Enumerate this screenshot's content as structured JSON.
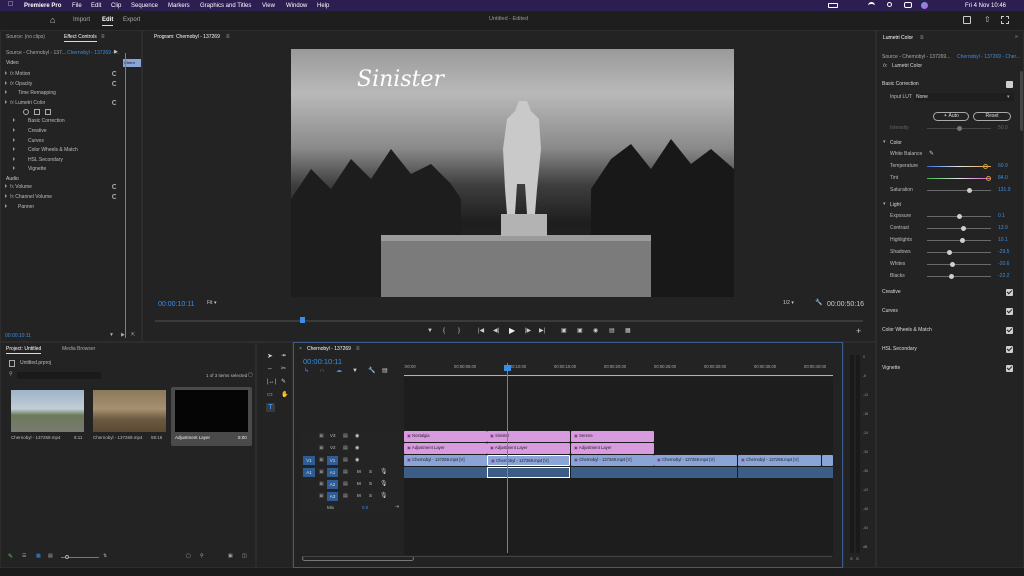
{
  "menubar": {
    "app": "Premiere Pro",
    "items": [
      "File",
      "Edit",
      "Clip",
      "Sequence",
      "Markers",
      "Graphics and Titles",
      "View",
      "Window",
      "Help"
    ],
    "datetime": "Fri 4 Nov  10:46"
  },
  "workspace": {
    "tabs": [
      "Import",
      "Edit",
      "Export"
    ],
    "active": "Edit",
    "title": "Untitled",
    "edited": " - Edited"
  },
  "source_panel": {
    "tab_source": "Source: (no clips)",
    "tab_effects": "Effect Controls",
    "source_label": "Source - Chernobyl - 137...",
    "seq_label": "Chernobyl - 137269 - ...",
    "clip_marker": "Chern",
    "video_header": "Video",
    "items": [
      {
        "label": "Motion",
        "fx": true,
        "indent": 1
      },
      {
        "label": "Opacity",
        "fx": true,
        "indent": 1
      },
      {
        "label": "Time Remapping",
        "fx": false,
        "indent": 1
      },
      {
        "label": "Lumetri Color",
        "fx": true,
        "indent": 1
      },
      {
        "label": "Basic Correction",
        "fx": false,
        "indent": 2
      },
      {
        "label": "Creative",
        "fx": false,
        "indent": 2
      },
      {
        "label": "Curves",
        "fx": false,
        "indent": 2
      },
      {
        "label": "Color Wheels & Match",
        "fx": false,
        "indent": 2
      },
      {
        "label": "HSL Secondary",
        "fx": false,
        "indent": 2
      },
      {
        "label": "Vignette",
        "fx": false,
        "indent": 2
      }
    ],
    "audio_header": "Audio",
    "audio_items": [
      "Volume",
      "Channel Volume",
      "Panner"
    ],
    "timecode": "00:00:10:11"
  },
  "program": {
    "tab": "Program: Chernobyl - 137269",
    "title_overlay": "Sinister",
    "timecode": "00:00:10:11",
    "fit": "Fit",
    "ratio": "1/2",
    "duration": "00:00:50:16"
  },
  "project": {
    "tab_project": "Project: Untitled",
    "tab_media": "Media Browser",
    "file": "Untitled.prproj",
    "selection": "1 of 3 items selected",
    "items": [
      {
        "name": "Chernobyl - 137269.mp4",
        "dur": "8:11"
      },
      {
        "name": "Chernobyl - 137269.mp4",
        "dur": "59:16"
      },
      {
        "name": "Adjustment Layer",
        "dur": "5:00"
      }
    ]
  },
  "timeline": {
    "tab": "Chernobyl - 137269",
    "timecode": "00:00:10:11",
    "ruler": [
      ":00:00",
      "00:00:05:00",
      "00:00:10:00",
      "00:00:15:00",
      "00:00:20:00",
      "00:00:25:00",
      "00:00:30:00",
      "00:00:35:00",
      "00:00:40:00"
    ],
    "tracks": {
      "v3": "V3",
      "v2": "V2",
      "v1": "V1",
      "a1": "A1",
      "a2": "A2",
      "a3": "A3",
      "mix": "Mix",
      "mixval": "0.0",
      "src_v": "V1",
      "src_a": "A1"
    },
    "v3_clips": [
      "Nostalgia",
      "Sinister",
      "Serene"
    ],
    "v2_clips": [
      "Adjustment Layer",
      "Adjustment Layer",
      "Adjustment Layer"
    ],
    "v1_clips": [
      "Chernobyl - 137269.mp4 [V]",
      "Chernobyl - 137269.mp4 [V]",
      "Chernobyl - 137269.mp4 [V]",
      "Chernobyl - 137269.mp4 [V]",
      "Chernobyl - 137269.mp4 [V]"
    ]
  },
  "vu_scale": [
    "0",
    "-6",
    "-12",
    "-18",
    "-24",
    "-30",
    "-36",
    "-42",
    "-48",
    "-54",
    "dB"
  ],
  "lumetri": {
    "tab": "Lumetri Color",
    "source_label": "Source - Chernobyl - 137269...",
    "seq_label": "Chernobyl - 137269 - Cher...",
    "effect": "Lumetri Color",
    "basic": "Basic Correction",
    "input_lut_label": "Input LUT",
    "input_lut_value": "None",
    "auto": "Auto",
    "reset": "Reset",
    "intensity_label": "Intensity",
    "intensity_value": "50.0",
    "color_header": "Color",
    "white_balance": "White Balance",
    "sliders_color": [
      {
        "label": "Temperature",
        "value": "60.9",
        "pos": 0.917
      },
      {
        "label": "Tint",
        "value": "84.0",
        "pos": 0.96
      },
      {
        "label": "Saturation",
        "value": "131.9",
        "pos": 0.66
      }
    ],
    "light_header": "Light",
    "sliders_light": [
      {
        "label": "Exposure",
        "value": "0.1",
        "pos": 0.5
      },
      {
        "label": "Contrast",
        "value": "13.9",
        "pos": 0.57
      },
      {
        "label": "Highlights",
        "value": "10.1",
        "pos": 0.55
      },
      {
        "label": "Shadows",
        "value": "-29.5",
        "pos": 0.35
      },
      {
        "label": "Whites",
        "value": "-20.6",
        "pos": 0.4
      },
      {
        "label": "Blacks",
        "value": "-22.2",
        "pos": 0.39
      }
    ],
    "sections": [
      "Creative",
      "Curves",
      "Color Wheels & Match",
      "HSL Secondary",
      "Vignette"
    ]
  }
}
